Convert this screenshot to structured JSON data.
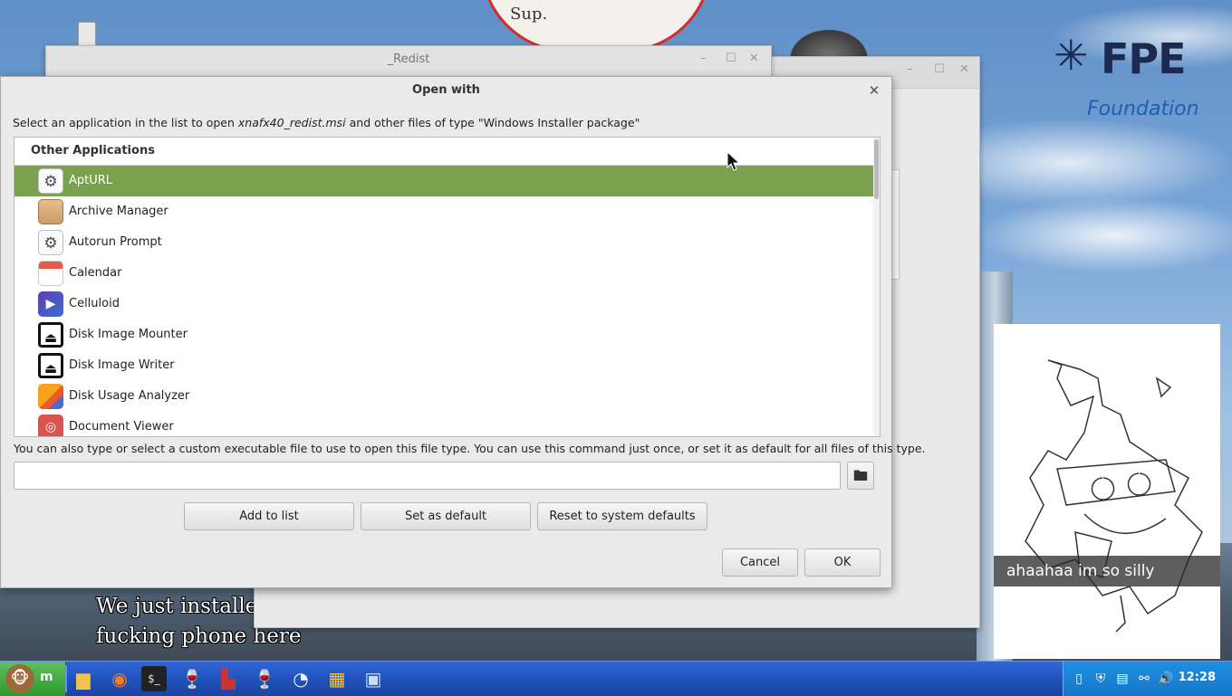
{
  "desktop": {
    "meme_caption_line1": "We just installed a gi",
    "meme_caption_line2": "fucking phone here",
    "drawing_caption": "ahaahaa im so silly",
    "sup_text": "Sup.",
    "logo_brand": "FPE",
    "logo_sub": "Foundation"
  },
  "windows": {
    "back_title": "_Redist"
  },
  "dialog": {
    "title": "Open with",
    "prompt_prefix": "Select an application in the list to open ",
    "prompt_file": "xnafx40_redist.msi",
    "prompt_suffix": " and other files of type \"Windows Installer package\"",
    "list_header": "Other Applications",
    "apps": [
      {
        "label": "AptURL",
        "icon": "gear-icon",
        "selected": true
      },
      {
        "label": "Archive Manager",
        "icon": "archive-icon",
        "selected": false
      },
      {
        "label": "Autorun Prompt",
        "icon": "gear-icon",
        "selected": false
      },
      {
        "label": "Calendar",
        "icon": "calendar-icon",
        "selected": false
      },
      {
        "label": "Celluloid",
        "icon": "play-icon",
        "selected": false
      },
      {
        "label": "Disk Image Mounter",
        "icon": "eject-icon",
        "selected": false
      },
      {
        "label": "Disk Image Writer",
        "icon": "eject-icon",
        "selected": false
      },
      {
        "label": "Disk Usage Analyzer",
        "icon": "pie-chart-icon",
        "selected": false
      },
      {
        "label": "Document Viewer",
        "icon": "glasses-icon",
        "selected": false
      }
    ],
    "custom_hint": "You can also type or select a custom executable file to use to open this file type.  You can use this command just once, or set it as default for all files of this type.",
    "command_value": "",
    "buttons": {
      "add_to_list": "Add to list",
      "set_as_default": "Set as default",
      "reset": "Reset to system defaults",
      "cancel": "Cancel",
      "ok": "OK"
    }
  },
  "taskbar": {
    "menu_label": "m",
    "clock": "12:28",
    "accent": "#2f67d8"
  },
  "colors": {
    "selection": "#7aa14d",
    "dialog_bg": "#eaeaea"
  }
}
